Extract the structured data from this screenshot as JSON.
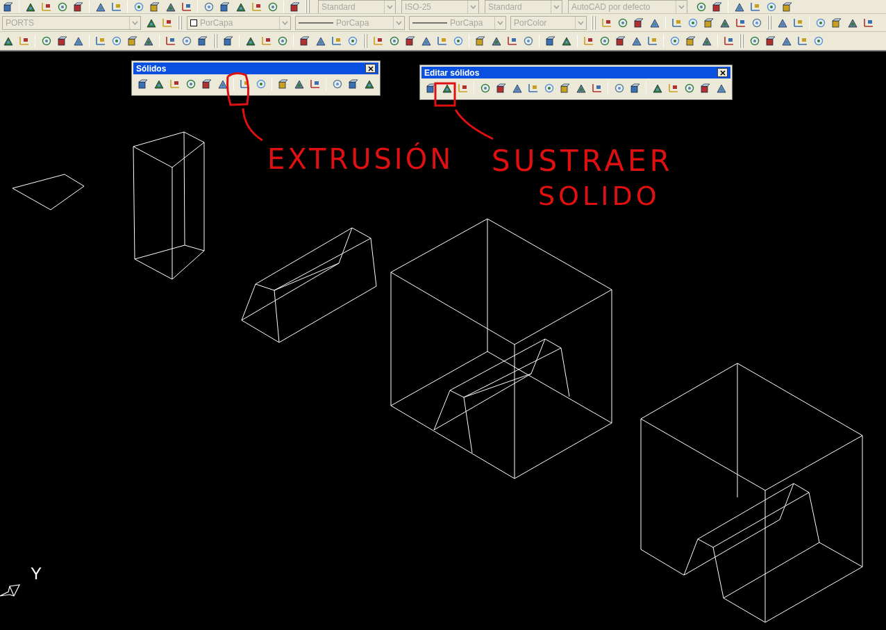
{
  "toolbars": {
    "row_1": {
      "dropdowns": [
        {
          "value": "Standard"
        },
        {
          "value": "ISO-25"
        },
        {
          "value": "Standard"
        },
        {
          "value": "AutoCAD por defecto"
        }
      ]
    },
    "row_2": {
      "dropdowns": [
        {
          "kind": "layer",
          "value": "PORTS"
        },
        {
          "kind": "color",
          "value": "PorCapa"
        },
        {
          "kind": "linetype",
          "value": "PorCapa"
        },
        {
          "kind": "lineweight",
          "value": "PorCapa"
        },
        {
          "kind": "plotstyle",
          "value": "PorColor"
        }
      ]
    }
  },
  "floating_toolbars": [
    {
      "title": "Sólidos"
    },
    {
      "title": "Editar sólidos"
    }
  ],
  "annotations": [
    {
      "text": "EXTRUSIÓN"
    },
    {
      "text": "SUSTRAER"
    },
    {
      "text": "SOLIDO"
    }
  ],
  "ucs": {
    "label": "Y"
  }
}
